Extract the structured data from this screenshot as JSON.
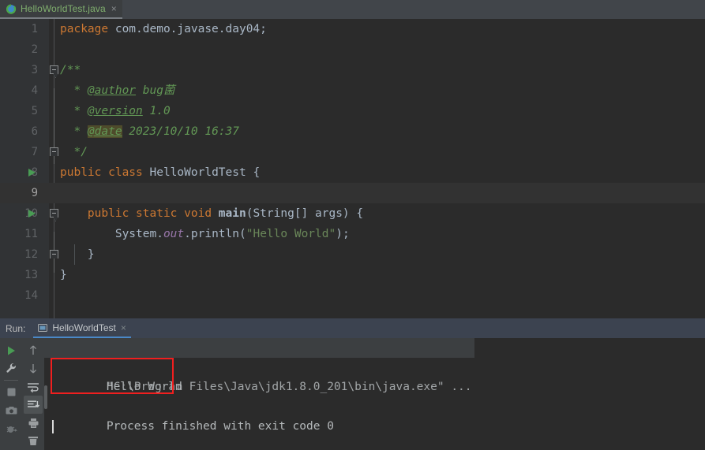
{
  "window": {
    "theme_accent": "#4a88c7",
    "editor_bg": "#2b2b2b",
    "panel_bg": "#3c3f41"
  },
  "editor_tabs": [
    {
      "label": "HelloWorldTest.java",
      "icon": "java-class-icon",
      "close_label": "×",
      "active": true
    }
  ],
  "editor": {
    "line_numbers": [
      "1",
      "2",
      "3",
      "4",
      "5",
      "6",
      "7",
      "8",
      "9",
      "10",
      "11",
      "12",
      "13",
      "14"
    ],
    "current_line": 9,
    "run_marker_lines": [
      8,
      10
    ],
    "lines": [
      {
        "n": 1,
        "tokens": [
          {
            "t": "package",
            "c": "kw"
          },
          {
            "t": " com.demo.javase.day04;",
            "c": "txt"
          }
        ]
      },
      {
        "n": 2,
        "tokens": []
      },
      {
        "n": 3,
        "tokens": [
          {
            "t": "/**",
            "c": "cmt"
          }
        ]
      },
      {
        "n": 4,
        "tokens": [
          {
            "t": "  * ",
            "c": "cmt"
          },
          {
            "t": "@author",
            "c": "tag"
          },
          {
            "t": " bug菌",
            "c": "cmt"
          }
        ]
      },
      {
        "n": 5,
        "tokens": [
          {
            "t": "  * ",
            "c": "cmt"
          },
          {
            "t": "@version",
            "c": "tag"
          },
          {
            "t": " 1.0",
            "c": "cmt"
          }
        ]
      },
      {
        "n": 6,
        "tokens": [
          {
            "t": "  * ",
            "c": "cmt"
          },
          {
            "t": "@date",
            "c": "tag-bad"
          },
          {
            "t": " 2023/10/10 16:37",
            "c": "cmt"
          }
        ]
      },
      {
        "n": 7,
        "tokens": [
          {
            "t": "  */",
            "c": "cmt"
          }
        ]
      },
      {
        "n": 8,
        "tokens": [
          {
            "t": "public class",
            "c": "kw"
          },
          {
            "t": " HelloWorldTest {",
            "c": "txt"
          }
        ]
      },
      {
        "n": 9,
        "tokens": []
      },
      {
        "n": 10,
        "tokens": [
          {
            "t": "    ",
            "c": "txt"
          },
          {
            "t": "public static void",
            "c": "kw"
          },
          {
            "t": " ",
            "c": "txt"
          },
          {
            "t": "main",
            "c": "fld"
          },
          {
            "t": "(String[] args) {",
            "c": "txt"
          }
        ]
      },
      {
        "n": 11,
        "tokens": [
          {
            "t": "        System.",
            "c": "txt"
          },
          {
            "t": "out",
            "c": "stat"
          },
          {
            "t": ".println(",
            "c": "txt"
          },
          {
            "t": "\"Hello World\"",
            "c": "str"
          },
          {
            "t": ");",
            "c": "txt"
          }
        ]
      },
      {
        "n": 12,
        "tokens": [
          {
            "t": "    }",
            "c": "txt"
          }
        ]
      },
      {
        "n": 13,
        "tokens": [
          {
            "t": "}",
            "c": "txt"
          }
        ]
      },
      {
        "n": 14,
        "tokens": []
      }
    ]
  },
  "run_panel": {
    "title": "Run:",
    "tab": {
      "label": "HelloWorldTest",
      "icon": "console-icon",
      "close_label": "×"
    },
    "left_toolbar": [
      {
        "name": "rerun-button",
        "icon": "play-icon"
      },
      {
        "name": "edit-configurations-button",
        "icon": "wrench-icon"
      },
      {
        "name": "stop-button",
        "icon": "stop-square-icon"
      },
      {
        "name": "screenshot-button",
        "icon": "camera-icon"
      },
      {
        "name": "rerun-failed-button",
        "icon": "debug-bug-icon"
      }
    ],
    "right_toolbar": [
      {
        "name": "up-button",
        "icon": "arrow-up-icon",
        "active": false
      },
      {
        "name": "down-button",
        "icon": "arrow-down-icon",
        "active": false
      },
      {
        "name": "soft-wrap-button",
        "icon": "soft-wrap-icon",
        "active": false
      },
      {
        "name": "scroll-to-end-button",
        "icon": "scroll-to-end-icon",
        "active": true
      },
      {
        "name": "print-button",
        "icon": "printer-icon",
        "active": false
      },
      {
        "name": "clear-all-button",
        "icon": "trash-icon",
        "active": false
      }
    ],
    "console": {
      "command_line": "\"C:\\Program Files\\Java\\jdk1.8.0_201\\bin\\java.exe\" ...",
      "output_line": "Hello World",
      "blank_line": "",
      "status_line": "Process finished with exit code 0",
      "highlight_color": "#f01f1f"
    }
  }
}
